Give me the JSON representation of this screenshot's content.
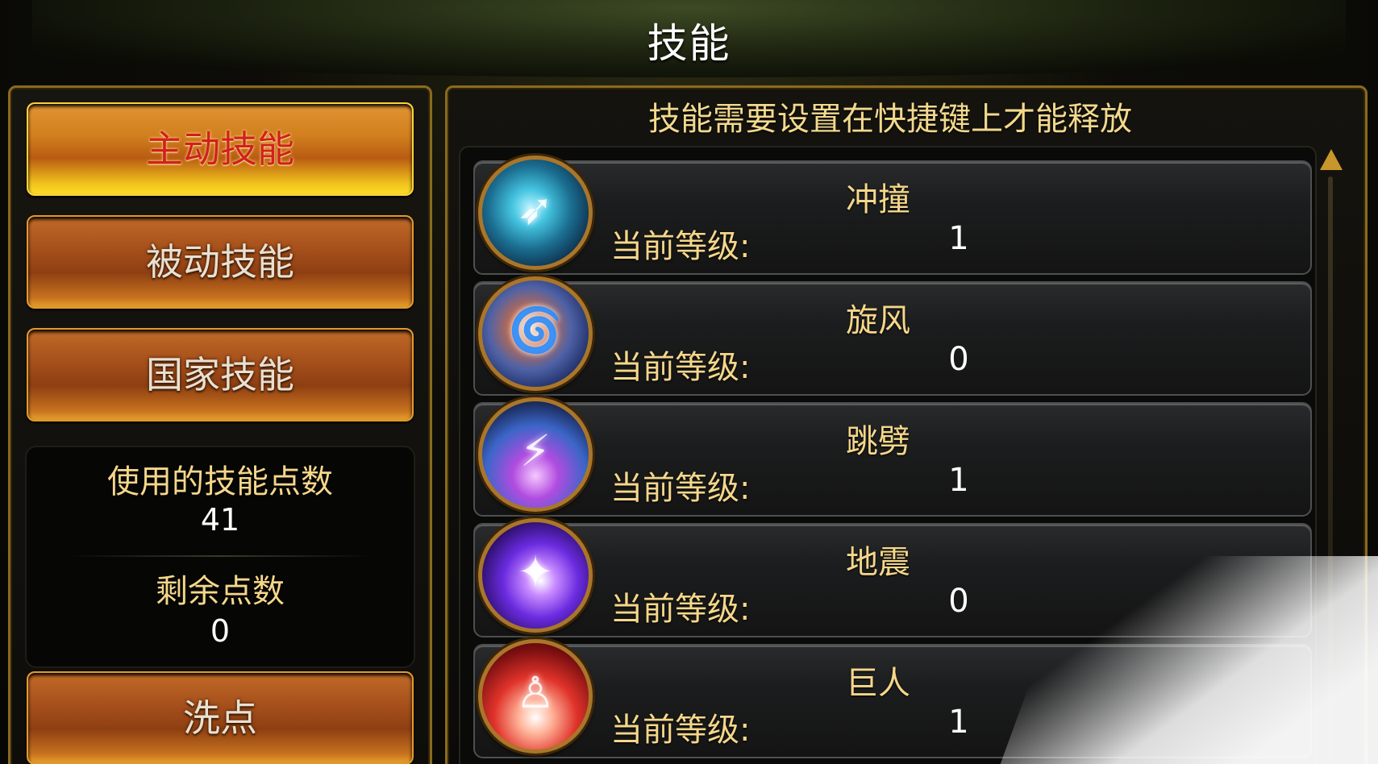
{
  "window": {
    "title": "技能"
  },
  "tabs": [
    {
      "label": "主动技能",
      "active": true
    },
    {
      "label": "被动技能",
      "active": false
    },
    {
      "label": "国家技能",
      "active": false
    }
  ],
  "stats": {
    "used_label": "使用的技能点数",
    "used_value": "41",
    "remaining_label": "剩余点数",
    "remaining_value": "0"
  },
  "reset_button": {
    "label": "洗点"
  },
  "hint": "技能需要设置在快捷键上才能释放",
  "level_label": "当前等级:",
  "skills": [
    {
      "name": "冲撞",
      "level": "1",
      "icon": "dash-skill-icon"
    },
    {
      "name": "旋风",
      "level": "0",
      "icon": "whirlwind-skill-icon"
    },
    {
      "name": "跳劈",
      "level": "1",
      "icon": "leap-strike-skill-icon"
    },
    {
      "name": "地震",
      "level": "0",
      "icon": "earthquake-skill-icon"
    },
    {
      "name": "巨人",
      "level": "1",
      "icon": "giant-skill-icon"
    }
  ],
  "colors": {
    "gold_text": "#f5d78a",
    "active_tab_text": "#d2201b",
    "frame_border": "#8a6a1e"
  }
}
